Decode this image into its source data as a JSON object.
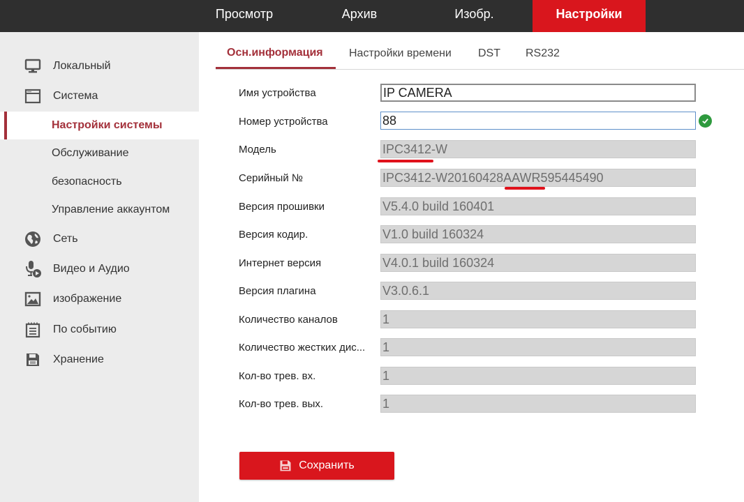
{
  "topnav": {
    "items": [
      {
        "label": "Просмотр",
        "active": false
      },
      {
        "label": "Архив",
        "active": false
      },
      {
        "label": "Изобр.",
        "active": false
      },
      {
        "label": "Настройки",
        "active": true
      }
    ]
  },
  "sidebar": {
    "items": [
      {
        "label": "Локальный",
        "icon": "monitor-icon",
        "type": "section"
      },
      {
        "label": "Система",
        "icon": "window-icon",
        "type": "section"
      },
      {
        "label": "Настройки системы",
        "type": "sub",
        "active": true
      },
      {
        "label": "Обслуживание",
        "type": "sub"
      },
      {
        "label": "безопасность",
        "type": "sub"
      },
      {
        "label": "Управление аккаунтом",
        "type": "sub"
      },
      {
        "label": "Сеть",
        "icon": "globe-icon",
        "type": "section"
      },
      {
        "label": "Видео и Аудио",
        "icon": "microphone-video-icon",
        "type": "section"
      },
      {
        "label": "изображение",
        "icon": "image-icon",
        "type": "section"
      },
      {
        "label": "По событию",
        "icon": "calendar-icon",
        "type": "section"
      },
      {
        "label": "Хранение",
        "icon": "floppy-disk-icon",
        "type": "section"
      }
    ]
  },
  "tabs": [
    {
      "label": "Осн.информация",
      "active": true
    },
    {
      "label": "Настройки времени",
      "active": false
    },
    {
      "label": "DST",
      "active": false
    },
    {
      "label": "RS232",
      "active": false
    }
  ],
  "form": {
    "fields": [
      {
        "label": "Имя устройства",
        "value": "IP CAMERA",
        "editable": true
      },
      {
        "label": "Номер устройства",
        "value": "88",
        "editable": true,
        "valid": true
      },
      {
        "label": "Модель",
        "value": "IPC3412-W",
        "editable": false
      },
      {
        "label": "Серийный №",
        "value": "IPC3412-W20160428AAWR595445490",
        "editable": false
      },
      {
        "label": "Версия прошивки",
        "value": "V5.4.0 build 160401",
        "editable": false
      },
      {
        "label": "Версия кодир.",
        "value": "V1.0 build 160324",
        "editable": false
      },
      {
        "label": "Интернет версия",
        "value": "V4.0.1 build 160324",
        "editable": false
      },
      {
        "label": "Версия плагина",
        "value": "V3.0.6.1",
        "editable": false
      },
      {
        "label": "Количество каналов",
        "value": "1",
        "editable": false
      },
      {
        "label": "Количество жестких дис...",
        "value": "1",
        "editable": false
      },
      {
        "label": "Кол-во трев. вх.",
        "value": "1",
        "editable": false
      },
      {
        "label": "Кол-во трев. вых.",
        "value": "1",
        "editable": false
      }
    ]
  },
  "save_button": {
    "label": "Сохранить"
  },
  "colors": {
    "accent_red": "#d9161d",
    "active_text": "#a3303a",
    "topbar_bg": "#2f2f2f",
    "sidebar_bg": "#ececec",
    "valid_green": "#2e9a3e",
    "annotation_red": "#e0121c"
  }
}
